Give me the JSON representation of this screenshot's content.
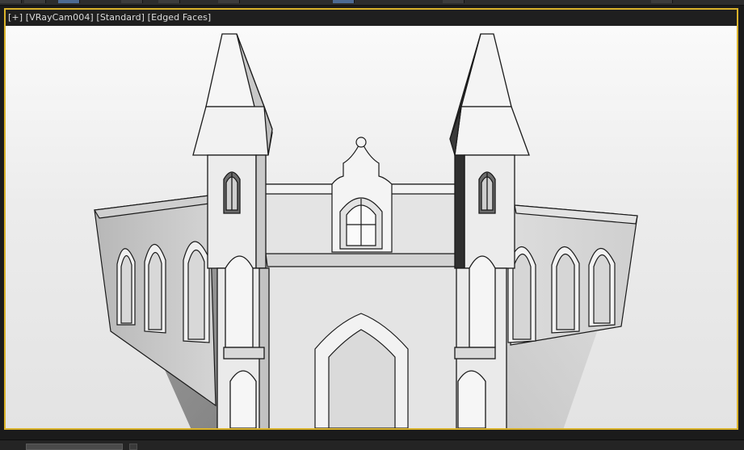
{
  "viewport": {
    "label_parts": {
      "plus": "[+]",
      "camera": "[VRayCam004]",
      "shading": "[Standard]",
      "edges": "[Edged Faces]"
    },
    "scene_description_icon": "building-model",
    "frame_color": "#d9b22a",
    "background_color": "#e9e9e9"
  },
  "toolbar": {
    "active_tool_color": "#4d6a92"
  }
}
